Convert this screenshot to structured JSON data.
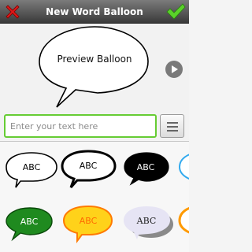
{
  "header": {
    "title": "New Word Balloon",
    "cancel_icon": "close-icon",
    "confirm_icon": "checkmark-icon"
  },
  "preview": {
    "text": "Preview Balloon",
    "next_icon": "play-arrow-icon"
  },
  "input": {
    "placeholder": "Enter your text here",
    "value": ""
  },
  "menu": {
    "icon": "hamburger-menu-icon"
  },
  "styles": [
    {
      "label": "ABC",
      "fill": "#ffffff",
      "stroke": "#000000",
      "text_color": "#000000",
      "style": "plain"
    },
    {
      "label": "ABC",
      "fill": "#ffffff",
      "stroke": "#000000",
      "text_color": "#000000",
      "style": "thick"
    },
    {
      "label": "ABC",
      "fill": "#000000",
      "stroke": "#000000",
      "text_color": "#ffffff",
      "style": "dark"
    },
    {
      "label": "",
      "fill": "#ffffff",
      "stroke": "#33aaee",
      "text_color": "#000000",
      "style": "partial"
    },
    {
      "label": "ABC",
      "fill": "#1f8a1f",
      "stroke": "#0a4a0a",
      "text_color": "#ffffff",
      "style": "green"
    },
    {
      "label": "ABC",
      "fill": "#ffd21a",
      "stroke": "#ff7a00",
      "text_color": "#ff6a00",
      "style": "yellow"
    },
    {
      "label": "ABC",
      "fill": "#e6e4f4",
      "stroke": "#e6e4f4",
      "text_color": "#222222",
      "style": "shadow"
    },
    {
      "label": "",
      "fill": "#ffffff",
      "stroke": "#ff9a00",
      "text_color": "#000000",
      "style": "partial"
    }
  ]
}
